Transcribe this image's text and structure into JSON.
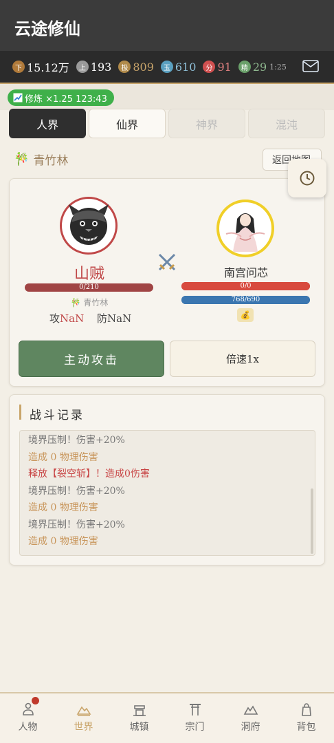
{
  "header": {
    "title": "云途修仙"
  },
  "resources": [
    {
      "icon": "下",
      "value": "15.12万",
      "color": "#b07a3a",
      "textColor": "#fff"
    },
    {
      "icon": "上",
      "value": "193",
      "color": "#9a9a9a",
      "textColor": "#fff"
    },
    {
      "icon": "极",
      "value": "809",
      "color": "#b08a4a",
      "textColor": "#c9a56b"
    },
    {
      "icon": "玉",
      "value": "610",
      "color": "#5aa0c0",
      "textColor": "#8fc0d8"
    },
    {
      "icon": "分",
      "value": "91",
      "color": "#d05050",
      "textColor": "#e08080"
    },
    {
      "icon": "精",
      "value": "29",
      "timer": "1:25",
      "color": "#6aa06a",
      "textColor": "#8fb88f"
    }
  ],
  "cultivation_badge": {
    "label": "修炼 ×1.25 123:43"
  },
  "realm_tabs": [
    {
      "label": "人界",
      "state": "active"
    },
    {
      "label": "仙界",
      "state": "normal"
    },
    {
      "label": "神界",
      "state": "disabled"
    },
    {
      "label": "混沌",
      "state": "disabled"
    }
  ],
  "location": {
    "name": "青竹林",
    "back_label": "返回地图"
  },
  "battle": {
    "enemy": {
      "name": "山贼",
      "hp_text": "0/210",
      "hp_fraction": 0,
      "location": "青竹林",
      "atk_label": "攻",
      "atk": "NaN",
      "def_label": "防",
      "def": "NaN"
    },
    "player": {
      "name": "南宫问芯",
      "hp_text": "0/0",
      "hp_fraction": 1,
      "mp_text": "768/690",
      "mp_fraction": 1
    },
    "attack_label": "主动攻击",
    "speed_label": "倍速1x"
  },
  "log": {
    "title": "战斗记录",
    "lines": [
      {
        "text": "境界压制！伤害+20%",
        "type": "normal"
      },
      {
        "text": "造成 0 物理伤害",
        "type": "damage"
      },
      {
        "text": "释放【裂空斩】！造成0伤害",
        "type": "skill"
      },
      {
        "text": "境界压制！伤害+20%",
        "type": "normal"
      },
      {
        "text": "造成 0 物理伤害",
        "type": "damage"
      },
      {
        "text": "境界压制！伤害+20%",
        "type": "normal"
      },
      {
        "text": "造成 0 物理伤害",
        "type": "damage"
      }
    ]
  },
  "nav": [
    {
      "label": "人物",
      "icon": "person-icon",
      "badge": true
    },
    {
      "label": "世界",
      "icon": "mountain-icon",
      "active": true
    },
    {
      "label": "城镇",
      "icon": "building-icon"
    },
    {
      "label": "宗门",
      "icon": "gate-icon"
    },
    {
      "label": "洞府",
      "icon": "cave-icon"
    },
    {
      "label": "背包",
      "icon": "bag-icon"
    }
  ]
}
